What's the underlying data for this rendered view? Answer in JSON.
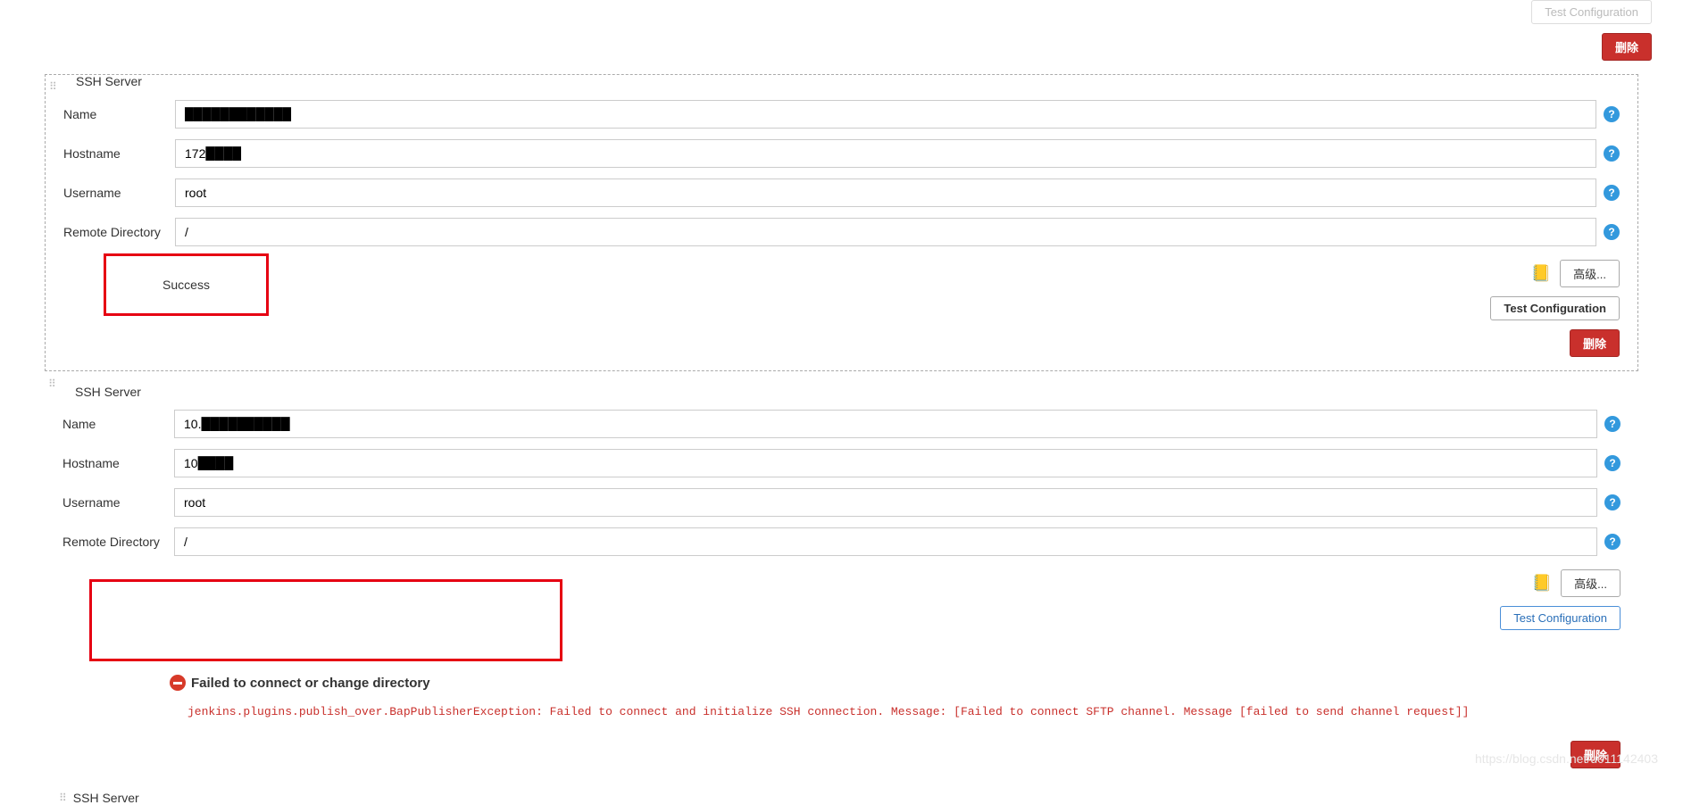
{
  "buttons": {
    "testConfig": "Test Configuration",
    "delete": "删除",
    "advanced": "高级..."
  },
  "labels": {
    "sshServer": "SSH Server",
    "name": "Name",
    "hostname": "Hostname",
    "username": "Username",
    "remoteDir": "Remote Directory"
  },
  "server1": {
    "name": "████████████",
    "hostname": "172████",
    "username": "root",
    "remoteDir": "/",
    "status": "Success"
  },
  "server2": {
    "name": "10.██████████",
    "hostname": "10████",
    "username": "root",
    "remoteDir": "/",
    "failTitle": "Failed to connect or change directory",
    "failMessage": "jenkins.plugins.publish_over.BapPublisherException: Failed to connect and initialize SSH connection. Message: [Failed to connect SFTP channel. Message [failed to send channel request]]"
  },
  "watermark": "https://blog.csdn.net/u011142403"
}
